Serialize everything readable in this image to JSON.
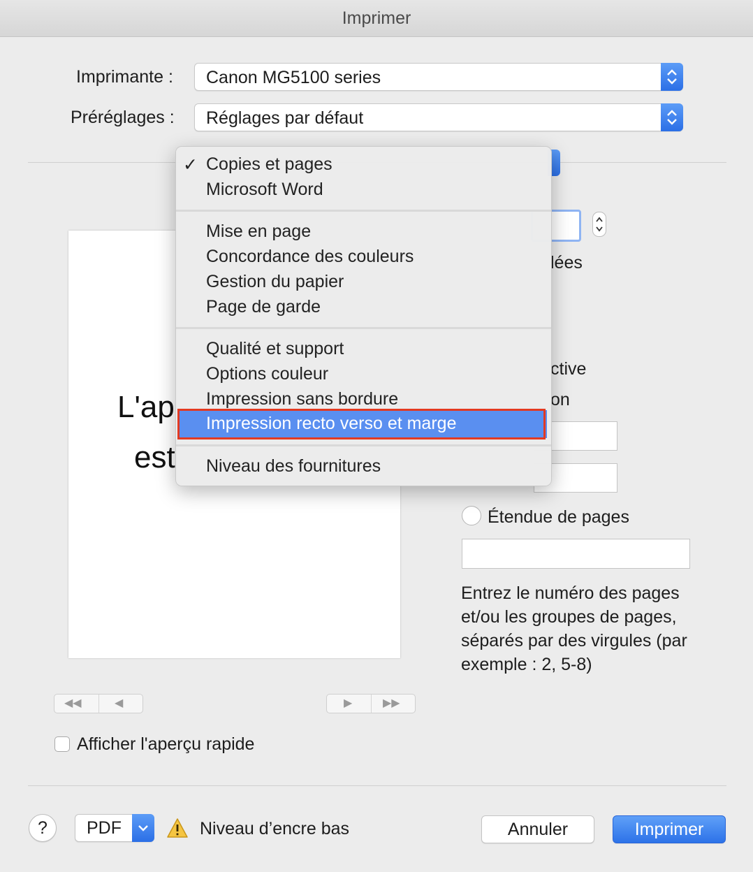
{
  "window": {
    "title": "Imprimer"
  },
  "printer": {
    "label": "Imprimante :",
    "value": "Canon MG5100 series"
  },
  "presets": {
    "label": "Préréglages :",
    "value": "Réglages par défaut"
  },
  "preview": {
    "line1": "L'ap",
    "line2": "est"
  },
  "quick_preview": {
    "label": "Afficher l'aperçu rapide",
    "checked": false
  },
  "right_panel": {
    "collated_fragment": "lées",
    "active_fragment": "ctive",
    "on_fragment": "on",
    "page_range_label": "Étendue de pages",
    "page_range_value": "",
    "hint": "Entrez le numéro des pages et/ou les groupes de pages, séparés par des virgules (par exemple : 2, 5-8)"
  },
  "menu": {
    "items": [
      {
        "label": "Copies et pages",
        "checked": true
      },
      {
        "label": "Microsoft Word"
      },
      {
        "label": "Mise en page"
      },
      {
        "label": "Concordance des couleurs"
      },
      {
        "label": "Gestion du papier"
      },
      {
        "label": "Page de garde"
      },
      {
        "label": "Qualité et support"
      },
      {
        "label": "Options couleur"
      },
      {
        "label": "Impression sans bordure"
      },
      {
        "label": "Impression recto verso et marge",
        "selected": true
      },
      {
        "label": "Niveau des fournitures"
      }
    ]
  },
  "bottom": {
    "help": "?",
    "pdf": "PDF",
    "warning": "Niveau d’encre bas",
    "cancel": "Annuler",
    "print": "Imprimer"
  },
  "colors": {
    "accent": "#2d72e8",
    "menu_selection": "#5a8ff0",
    "highlight": "#e23a22"
  }
}
